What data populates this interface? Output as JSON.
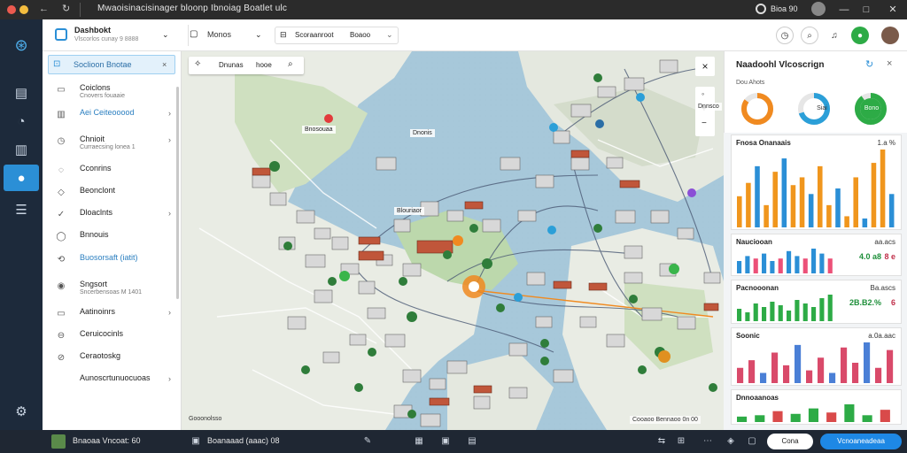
{
  "window": {
    "title": "Mwaoisinacisinager bloonp Ibnoiag Boatlet ulc",
    "right_label": "Bioa 90",
    "controls": {
      "min": "—",
      "max": "□",
      "close": "✕"
    }
  },
  "header": {
    "app_name": "Dashbokt",
    "app_sub": "Vlscorlos cunay 9 8888",
    "dropdown_label": "Monos",
    "search_label": "Scoraanroot",
    "filter_label": "Boaoo"
  },
  "sidebar": {
    "search_label": "Soclioon Bnotae",
    "items": [
      {
        "label": "Coiclons",
        "sub": "Cnovers fouaaie",
        "icon": "list-icon",
        "chevron": false
      },
      {
        "label": "Aei Ceiteooood",
        "sub": "",
        "icon": "chart-icon",
        "chevron": true
      },
      {
        "label": "Chnioit",
        "sub": "Curraecsing lonea 1",
        "icon": "clock-icon",
        "chevron": true
      },
      {
        "label": "Cconrins",
        "sub": "",
        "icon": "user-icon",
        "chevron": false
      },
      {
        "label": "Beonclont",
        "sub": "",
        "icon": "layers-icon",
        "chevron": false
      },
      {
        "label": "Dloaclnts",
        "sub": "",
        "icon": "check-icon",
        "chevron": true
      },
      {
        "label": "Bnnouis",
        "sub": "",
        "icon": "globe-icon",
        "chevron": false
      },
      {
        "label": "Buosorsaft (iatit)",
        "sub": "",
        "icon": "sync-icon",
        "chevron": false
      },
      {
        "label": "Sngsort",
        "sub": "Sncerbensoas M 1401",
        "icon": "support-icon",
        "chevron": false
      },
      {
        "label": "Aatinoinrs",
        "sub": "",
        "icon": "folder-icon",
        "chevron": true
      },
      {
        "label": "Ceruicocinls",
        "sub": "",
        "icon": "link-icon",
        "chevron": false
      },
      {
        "label": "Ceraotoskg",
        "sub": "",
        "icon": "settings-icon",
        "chevron": false
      },
      {
        "label": "Aunoscrtunuocuoas",
        "sub": "",
        "icon": "",
        "chevron": true
      }
    ]
  },
  "map": {
    "toolbar": {
      "btn1": "Dnunas",
      "btn2": "hooe"
    },
    "labels": [
      "Bnosouaa",
      "Dnonis",
      "Blouriaor",
      "Dnnsco"
    ],
    "footer_left": "Gooonolsso",
    "footer_right": "Cooaoo Bennaoo 0n 00"
  },
  "right_panel": {
    "title": "Naadoohl Vlcoscrign",
    "subtitle": "Dou Ahots",
    "donuts": [
      {
        "label": "",
        "value": 0.85,
        "color": "#f08a20"
      },
      {
        "label": "Siai",
        "value": 0.7,
        "color": "#2b9fd8"
      },
      {
        "label": "Bono",
        "value": 0.9,
        "color": "#2dab46"
      }
    ],
    "cards": [
      {
        "title": "Fnosa Onanaais",
        "value": "1.a %",
        "colors": [
          "#f0961d",
          "#2b8fd6"
        ]
      },
      {
        "title": "Nauciooan",
        "value": "aa.acs",
        "stat1": "4.0 a8",
        "stat2": "8 e",
        "colors": [
          "#2b8fd6",
          "#ec5078"
        ]
      },
      {
        "title": "Pacnooonan",
        "value": "Ba.ascs",
        "stat1": "2B.B2.%",
        "stat2": "6",
        "colors": [
          "#2dab46",
          "#2dab46"
        ]
      },
      {
        "title": "Soonic",
        "value": "a.0a.aac",
        "colors": [
          "#d94a6a",
          "#4a7fd6"
        ]
      },
      {
        "title": "Dnnoaanoas",
        "value": "",
        "colors": [
          "#2dab46",
          "#d94a4a"
        ]
      }
    ]
  },
  "footer": {
    "user": "Bnaoaa Vncoat: 60",
    "doc": "Boanaaad (aaac) 08",
    "right_icons": [
      "share-icon",
      "grid-icon"
    ],
    "cancel": "Cona",
    "primary": "Vcnoaneadeaa",
    "colors": {
      "primary": "#1e88e5",
      "accent": "#2b8fd6"
    }
  }
}
